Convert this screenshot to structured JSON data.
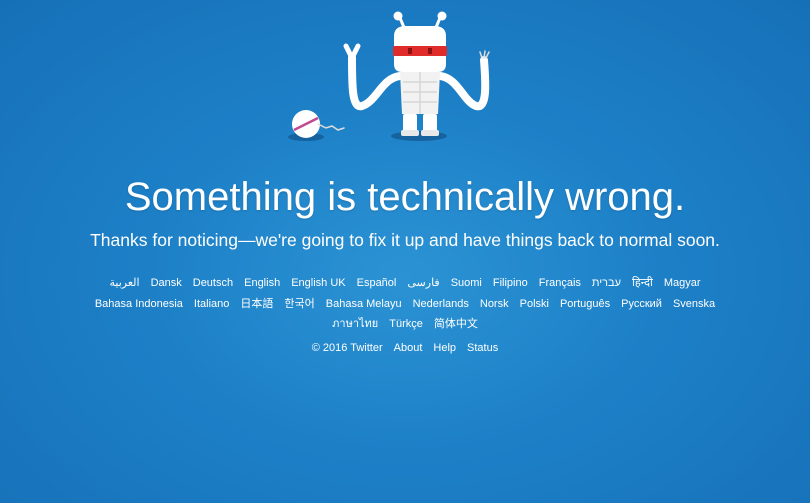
{
  "error": {
    "headline": "Something is technically wrong.",
    "subline": "Thanks for noticing—we're going to fix it up and have things back to normal soon."
  },
  "illustration": {
    "icon": "broken-robot-illustration"
  },
  "languages": [
    "العربية",
    "Dansk",
    "Deutsch",
    "English",
    "English UK",
    "Español",
    "فارسی",
    "Suomi",
    "Filipino",
    "Français",
    "עברית",
    "हिन्दी",
    "Magyar",
    "Bahasa Indonesia",
    "Italiano",
    "日本語",
    "한국어",
    "Bahasa Melayu",
    "Nederlands",
    "Norsk",
    "Polski",
    "Português",
    "Русский",
    "Svenska",
    "ภาษาไทย",
    "Türkçe",
    "简体中文"
  ],
  "footer": {
    "copyright": "© 2016 Twitter",
    "about": "About",
    "help": "Help",
    "status": "Status"
  },
  "colors": {
    "background": "#1d80c7",
    "text": "#ffffff",
    "robot_visor": "#e02b2b",
    "robot_shadow": "#135a94"
  }
}
